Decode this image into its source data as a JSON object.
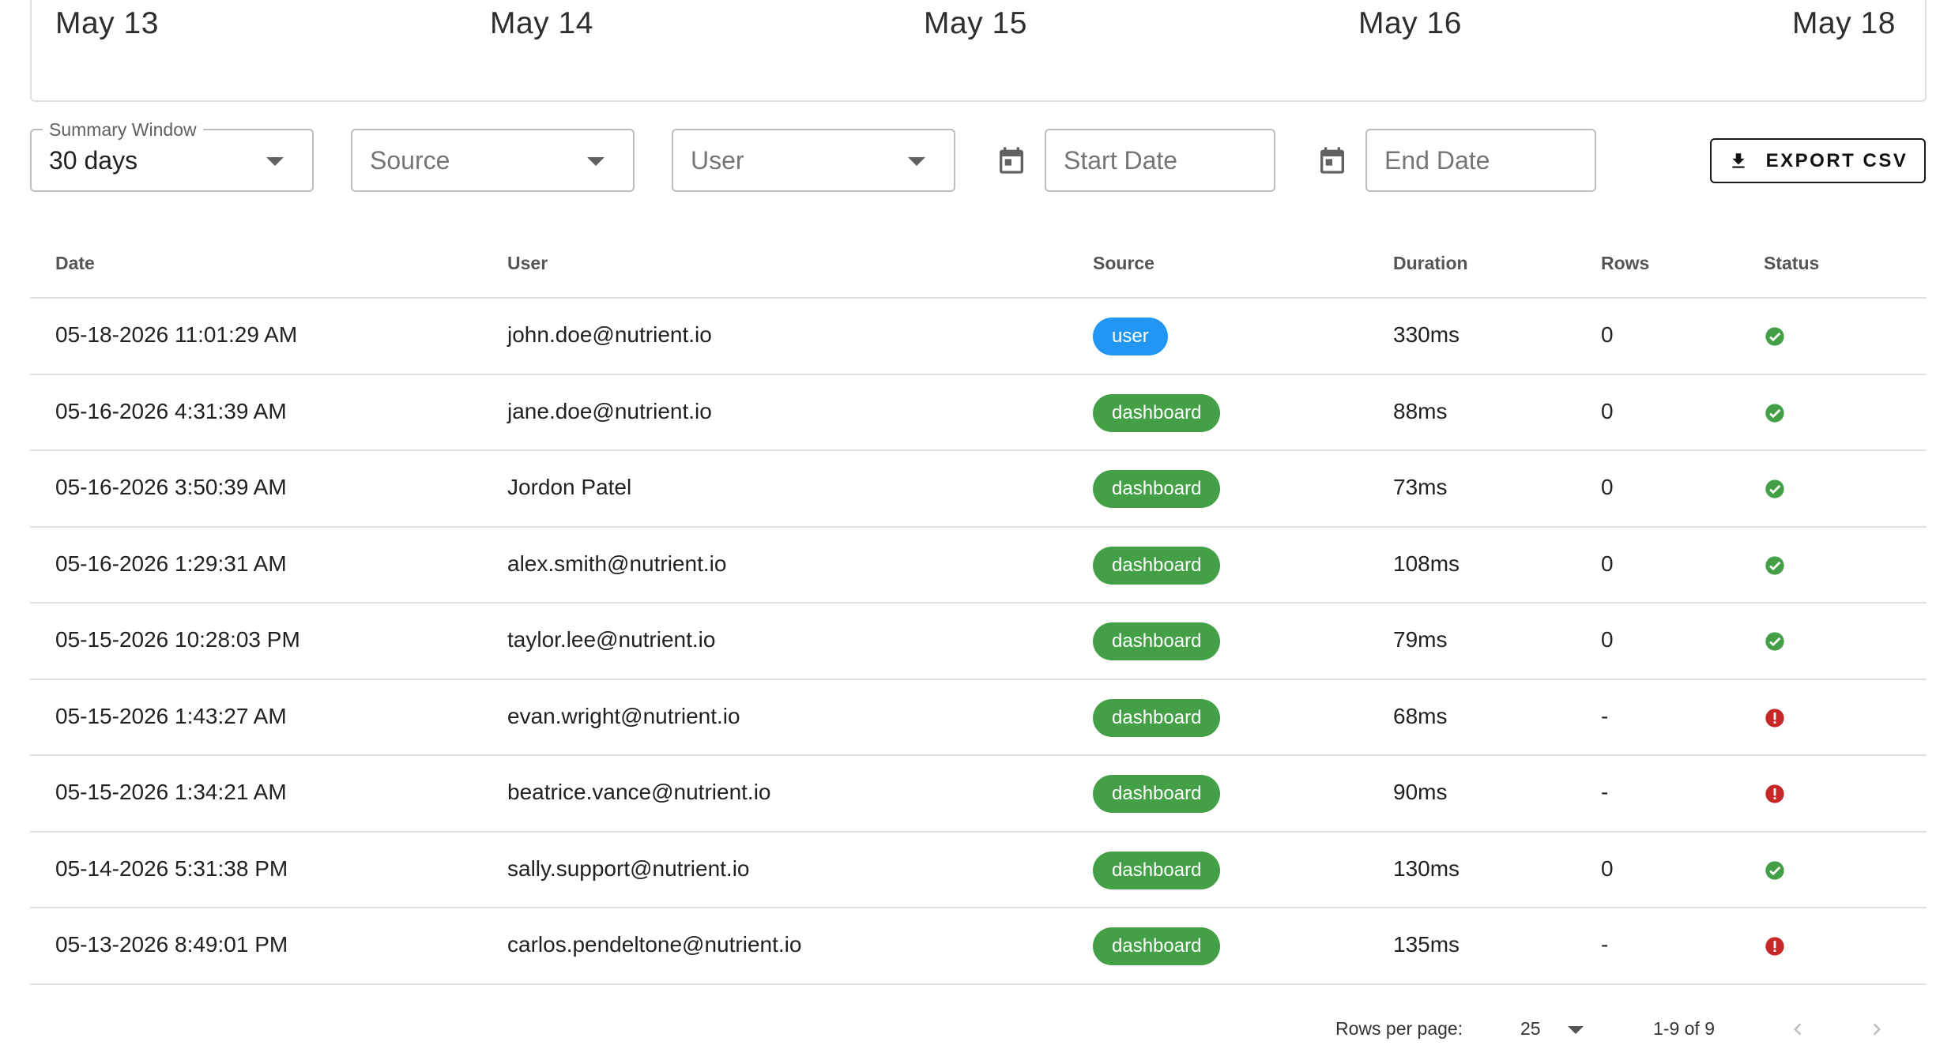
{
  "timeline": {
    "labels": [
      "May 13",
      "May 14",
      "May 15",
      "May 16",
      "May 18"
    ]
  },
  "filters": {
    "summary_window": {
      "label": "Summary Window",
      "value": "30 days"
    },
    "source": {
      "placeholder": "Source"
    },
    "user": {
      "placeholder": "User"
    },
    "start_date": {
      "placeholder": "Start Date"
    },
    "end_date": {
      "placeholder": "End Date"
    },
    "export_label": "EXPORT CSV"
  },
  "table": {
    "headers": {
      "date": "Date",
      "user": "User",
      "source": "Source",
      "duration": "Duration",
      "rows": "Rows",
      "status": "Status"
    },
    "rows": [
      {
        "date": "05-18-2026 11:01:29 AM",
        "user": "john.doe@nutrient.io",
        "source": "user",
        "duration": "330ms",
        "rows": "0",
        "status": "success"
      },
      {
        "date": "05-16-2026 4:31:39 AM",
        "user": "jane.doe@nutrient.io",
        "source": "dashboard",
        "duration": "88ms",
        "rows": "0",
        "status": "success"
      },
      {
        "date": "05-16-2026 3:50:39 AM",
        "user": "Jordon Patel",
        "source": "dashboard",
        "duration": "73ms",
        "rows": "0",
        "status": "success"
      },
      {
        "date": "05-16-2026 1:29:31 AM",
        "user": "alex.smith@nutrient.io",
        "source": "dashboard",
        "duration": "108ms",
        "rows": "0",
        "status": "success"
      },
      {
        "date": "05-15-2026 10:28:03 PM",
        "user": "taylor.lee@nutrient.io",
        "source": "dashboard",
        "duration": "79ms",
        "rows": "0",
        "status": "success"
      },
      {
        "date": "05-15-2026 1:43:27 AM",
        "user": "evan.wright@nutrient.io",
        "source": "dashboard",
        "duration": "68ms",
        "rows": "-",
        "status": "error"
      },
      {
        "date": "05-15-2026 1:34:21 AM",
        "user": "beatrice.vance@nutrient.io",
        "source": "dashboard",
        "duration": "90ms",
        "rows": "-",
        "status": "error"
      },
      {
        "date": "05-14-2026 5:31:38 PM",
        "user": "sally.support@nutrient.io",
        "source": "dashboard",
        "duration": "130ms",
        "rows": "0",
        "status": "success"
      },
      {
        "date": "05-13-2026 8:49:01 PM",
        "user": "carlos.pendeltone@nutrient.io",
        "source": "dashboard",
        "duration": "135ms",
        "rows": "-",
        "status": "error"
      }
    ]
  },
  "pagination": {
    "rows_per_page_label": "Rows per page:",
    "rows_per_page": "25",
    "range": "1-9 of 9"
  },
  "colors": {
    "user_chip": "#2196f3",
    "dashboard_chip": "#43a047",
    "success": "#43a047",
    "error": "#c62828"
  }
}
